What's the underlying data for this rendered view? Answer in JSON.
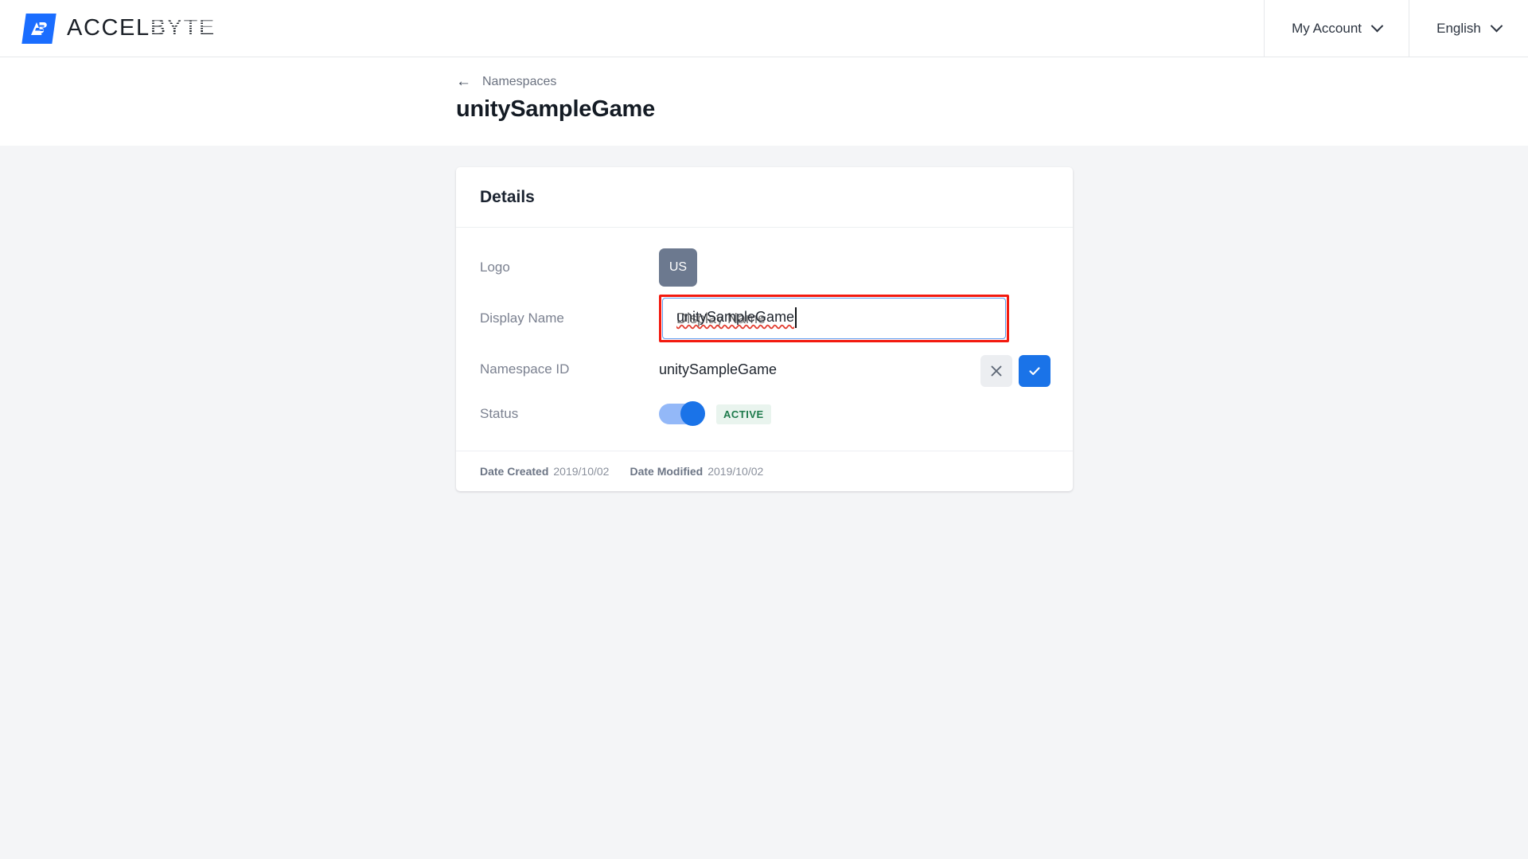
{
  "header": {
    "brand_accel": "ACCEL",
    "brand_byte": "BYTE",
    "brand_monogram": "AB",
    "account_label": "My Account",
    "language_label": "English"
  },
  "page": {
    "breadcrumb_label": "Namespaces",
    "back_arrow": "←",
    "title": "unitySampleGame"
  },
  "card": {
    "header_title": "Details",
    "rows": {
      "logo": {
        "label": "Logo",
        "badge_text": "US"
      },
      "display_name": {
        "label": "Display Name",
        "value": "unitySampleGame",
        "placeholder": "Display Name"
      },
      "namespace_id": {
        "label": "Namespace ID",
        "value": "unitySampleGame",
        "cancel_icon": "close-icon",
        "confirm_icon": "check-icon"
      },
      "status": {
        "label": "Status",
        "toggle_state": "on",
        "badge_text": "ACTIVE"
      }
    },
    "footer": {
      "date_created_label": "Date Created",
      "date_created_value": "2019/10/02",
      "date_modified_label": "Date Modified",
      "date_modified_value": "2019/10/02"
    }
  },
  "colors": {
    "brand_blue": "#1a6dff",
    "accent_blue": "#1a73e8",
    "annotation_red": "#f31a0f",
    "focus_blue": "#5b9bf0",
    "logo_badge_slate": "#6c798f",
    "status_green_text": "#1d7a4b",
    "status_green_bg": "#e9f4ee",
    "page_bg": "#f4f5f7"
  }
}
